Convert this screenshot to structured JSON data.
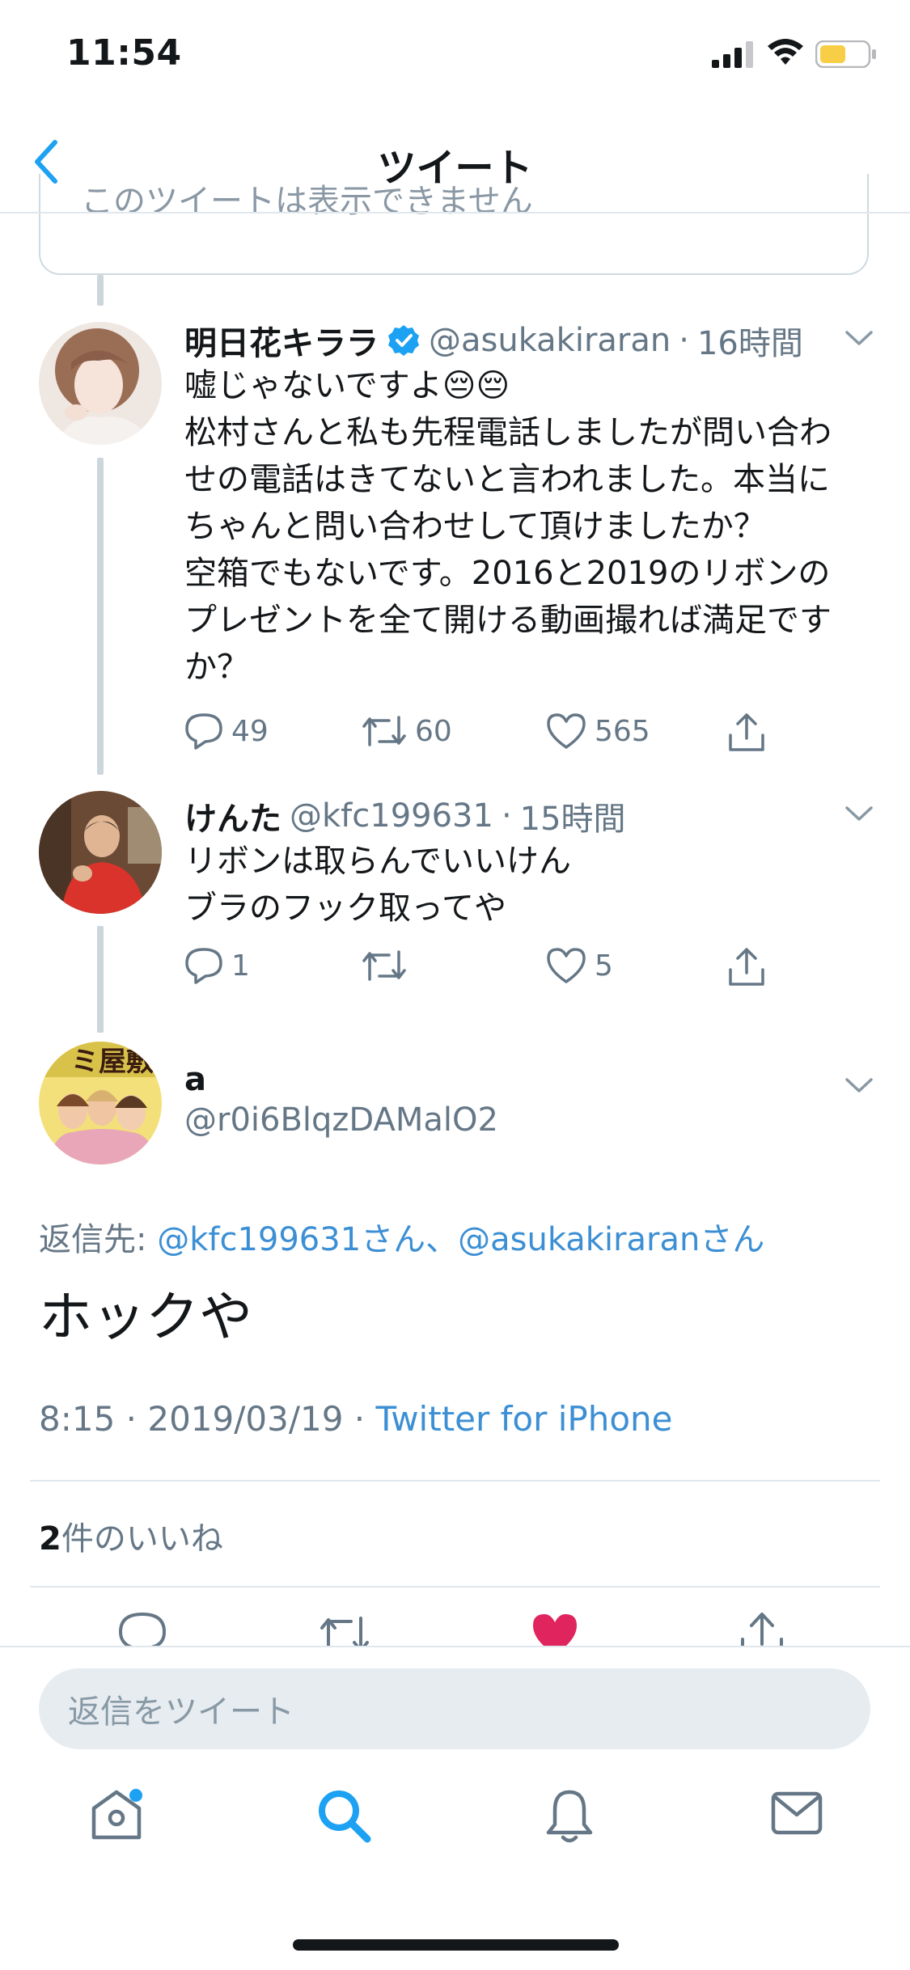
{
  "status_bar": {
    "time": "11:54"
  },
  "nav": {
    "title": "ツイート"
  },
  "hidden_tweet": {
    "text": "このツイートは表示できません"
  },
  "tweets": [
    {
      "name": "明日花キララ",
      "verified": true,
      "handle": "@asukakiraran",
      "time": "16時間",
      "lines": [
        "嘘じゃないですよ😔😔",
        "松村さんと私も先程電話しましたが問い合わ",
        "せの電話はきてないと言われました。本当に",
        "ちゃんと問い合わせして頂けましたか？",
        "空箱でもないです。2016と2019のリボンの",
        "プレゼントを全て開ける動画撮れば満足です",
        "か？"
      ],
      "replies": "49",
      "retweets": "60",
      "likes": "565"
    },
    {
      "name": "けんた",
      "verified": false,
      "handle": "@kfc199631",
      "time": "15時間",
      "lines": [
        "リボンは取らんでいいけん",
        "ブラのフック取ってや"
      ],
      "replies": "1",
      "retweets": "",
      "likes": "5"
    }
  ],
  "main_tweet": {
    "name": "a",
    "handle": "@r0i6BlqzDAMalO2",
    "reply_to_label": "返信先: ",
    "reply_to_users": "@kfc199631さん、@asukakiraranさん",
    "text": "ホックや",
    "timestamp": "8:15 · 2019/03/19 · ",
    "source": "Twitter for iPhone",
    "likes_count": "2",
    "likes_label": "件のいいね"
  },
  "reply_bar": {
    "placeholder": "返信をツイート"
  },
  "tab_bar": {
    "items": [
      "home-icon",
      "search-icon",
      "notifications-icon",
      "messages-icon"
    ],
    "active": "search-icon"
  },
  "colors": {
    "accent": "#1da1f2",
    "like_red": "#e0245e",
    "gray": "#657786"
  }
}
